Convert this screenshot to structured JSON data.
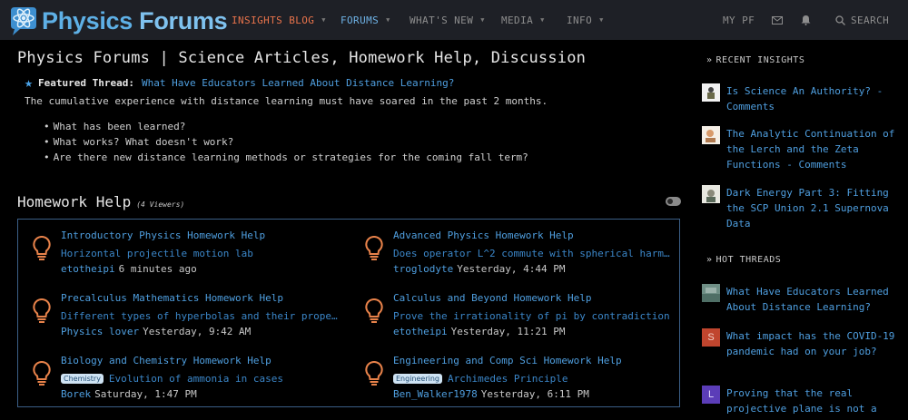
{
  "header": {
    "logo": {
      "word1": "Physics",
      "word2": "Forums"
    },
    "nav": {
      "insights": "INSIGHTS BLOG",
      "forums": "FORUMS",
      "whats_new": "WHAT'S NEW",
      "media": "MEDIA",
      "info": "INFO",
      "my_pf": "MY PF",
      "search": "SEARCH"
    },
    "colors": {
      "bar": "#1e2026",
      "insights": "#e8734b",
      "forums": "#6eb2e6",
      "logo": "#5eb0e6"
    }
  },
  "main": {
    "title": "Physics Forums | Science Articles, Homework Help, Discussion",
    "featured": {
      "label": "Featured Thread:",
      "link": "What Have Educators Learned About Distance Learning?",
      "description": "The cumulative experience with distance learning must have soared in the past 2 months.",
      "bullets": [
        "What has been learned?",
        "What works? What doesn't work?",
        "Are there new distance learning methods or strategies for the coming fall term?"
      ]
    },
    "section": {
      "title": "Homework Help",
      "viewers": "(4 Viewers)"
    },
    "forums": [
      {
        "title": "Introductory Physics Homework Help",
        "thread": "Horizontal projectile motion lab",
        "tag": "",
        "user": "etotheipi",
        "time": "6 minutes ago"
      },
      {
        "title": "Advanced Physics Homework Help",
        "thread": "Does operator L^2 commute with spherical harmon…",
        "tag": "",
        "user": "troglodyte",
        "time": "Yesterday, 4:44 PM"
      },
      {
        "title": "Precalculus Mathematics Homework Help",
        "thread": "Different types of hyperbolas and their propert…",
        "tag": "",
        "user": "Physics lover",
        "time": "Yesterday, 9:42 AM"
      },
      {
        "title": "Calculus and Beyond Homework Help",
        "thread": "Prove the irrationality of pi by contradiction",
        "tag": "",
        "user": "etotheipi",
        "time": "Yesterday, 11:21 PM"
      },
      {
        "title": "Biology and Chemistry Homework Help",
        "thread": "Evolution of ammonia in cases",
        "tag": "Chemistry",
        "user": "Borek",
        "time": "Saturday, 1:47 PM"
      },
      {
        "title": "Engineering and Comp Sci Homework Help",
        "thread": "Archimedes Principle",
        "tag": "Engineering",
        "user": "Ben_Walker1978",
        "time": "Yesterday, 6:11 PM"
      }
    ]
  },
  "sidebar": {
    "recent_insights": {
      "heading": "RECENT INSIGHTS",
      "items": [
        {
          "text": "Is Science An Authority? - Comments"
        },
        {
          "text": "The Analytic Continuation of the Lerch and the Zeta Functions - Comments"
        },
        {
          "text": "Dark Energy Part 3: Fitting the SCP Union 2.1 Supernova Data"
        }
      ]
    },
    "hot_threads": {
      "heading": "HOT THREADS",
      "items": [
        {
          "text": "What Have Educators Learned About Distance Learning?",
          "avatar": ""
        },
        {
          "text": "What impact has the COVID-19 pandemic had on your job?",
          "avatar": "S"
        },
        {
          "text": "Proving that the real projective plane is not a",
          "avatar": "L"
        }
      ]
    }
  }
}
